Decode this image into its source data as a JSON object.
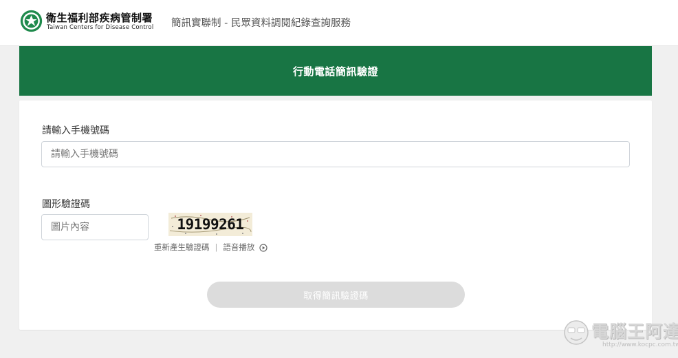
{
  "header": {
    "org_name": "衛生福利部疾病管制署",
    "org_name_en": "Taiwan Centers for Disease Control",
    "service_title": "簡訊實聯制 - 民眾資料調閱紀錄查詢服務",
    "logo_icon": "cdc-logo-icon"
  },
  "banner": {
    "title": "行動電話簡訊驗證"
  },
  "form": {
    "phone_label": "請輸入手機號碼",
    "phone_placeholder": "請輸入手機號碼",
    "phone_value": "",
    "captcha_label": "圖形驗證碼",
    "captcha_placeholder": "圖片內容",
    "captcha_value": "",
    "captcha_image_text": "19199261",
    "regenerate_label": "重新產生驗證碼",
    "separator": "|",
    "audio_label": "語音播放",
    "audio_icon": "play-circle-icon",
    "submit_label": "取得簡訊驗證碼"
  },
  "watermark": {
    "text": "電腦王阿達",
    "url": "http://www.kocpc.com.tw"
  },
  "colors": {
    "brand_green": "#187544",
    "page_bg": "#f0f0f0",
    "button_disabled": "#dcdcdc"
  }
}
